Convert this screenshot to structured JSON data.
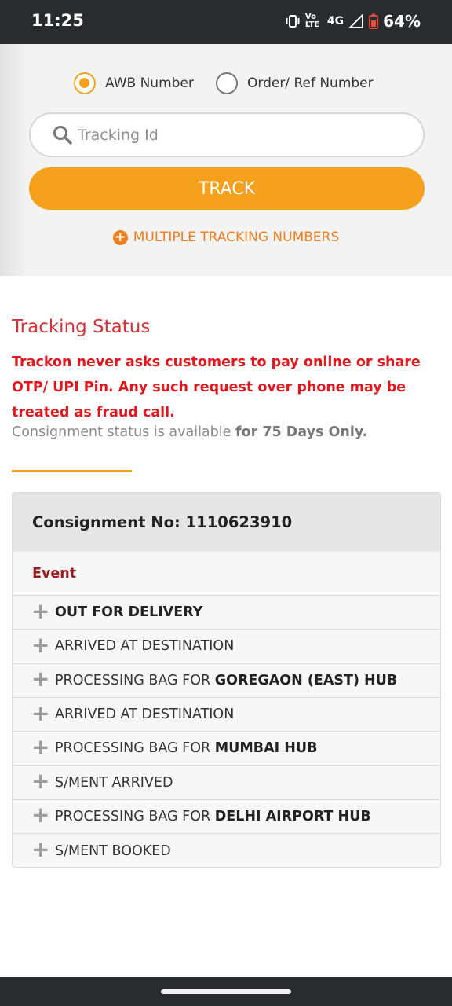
{
  "status_bar": {
    "time": "11:25",
    "network": "4G",
    "volte": "Vo LTE",
    "battery": "64%"
  },
  "search_mode": {
    "options": [
      {
        "label": "AWB Number",
        "selected": true
      },
      {
        "label": "Order/ Ref Number",
        "selected": false
      }
    ]
  },
  "search": {
    "placeholder": "Tracking Id",
    "value": ""
  },
  "track_button": {
    "label": "TRACK"
  },
  "multi_link": {
    "label": "MULTIPLE TRACKING NUMBERS"
  },
  "tracking": {
    "title": "Tracking Status",
    "warning": "Trackon never asks customers to pay online or share OTP/ UPI Pin. Any such request over phone may be treated as fraud call.",
    "availability_prefix": "Consignment status is available",
    "availability_bold": "for 75 Days Only."
  },
  "consignment": {
    "header": "Consignment No: 1110623910",
    "column_header": "Event",
    "events": [
      {
        "prefix": "",
        "bold": "OUT FOR DELIVERY"
      },
      {
        "prefix": "ARRIVED AT DESTINATION",
        "bold": ""
      },
      {
        "prefix": "PROCESSING BAG FOR ",
        "bold": "GOREGAON (EAST) HUB"
      },
      {
        "prefix": "ARRIVED AT DESTINATION",
        "bold": ""
      },
      {
        "prefix": "PROCESSING BAG FOR ",
        "bold": "MUMBAI HUB"
      },
      {
        "prefix": "S/MENT ARRIVED",
        "bold": ""
      },
      {
        "prefix": "PROCESSING BAG FOR ",
        "bold": "DELHI AIRPORT HUB"
      },
      {
        "prefix": "S/MENT BOOKED",
        "bold": ""
      }
    ]
  },
  "colors": {
    "accent": "#f6a11e",
    "link": "#f07e1c",
    "title_red": "#d2343a",
    "warning_red": "#e2171e",
    "event_header": "#991c1c"
  }
}
